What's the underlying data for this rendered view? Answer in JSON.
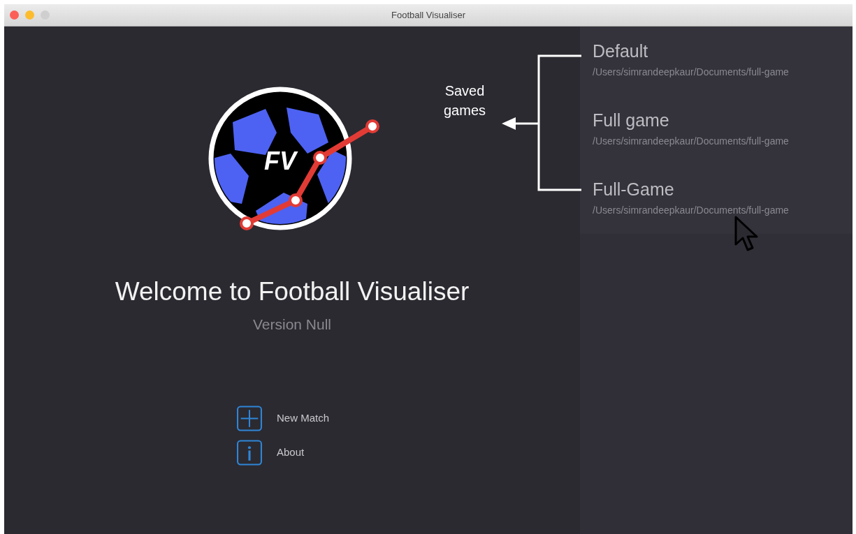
{
  "window": {
    "title": "Football Visualiser"
  },
  "welcome": {
    "logo_text": "FV",
    "title": "Welcome to Football Visualiser",
    "version": "Version Null"
  },
  "actions": [
    {
      "kind": "new",
      "label": "New Match"
    },
    {
      "kind": "about",
      "label": "About"
    }
  ],
  "saved_games": [
    {
      "name": "Default",
      "path": "/Users/simrandeepkaur/Documents/full-game",
      "selected": false
    },
    {
      "name": "Full game",
      "path": "/Users/simrandeepkaur/Documents/full-game",
      "selected": false
    },
    {
      "name": "Full-Game",
      "path": "/Users/simrandeepkaur/Documents/full-game",
      "selected": false
    }
  ],
  "annotation": {
    "label": "Saved games"
  }
}
